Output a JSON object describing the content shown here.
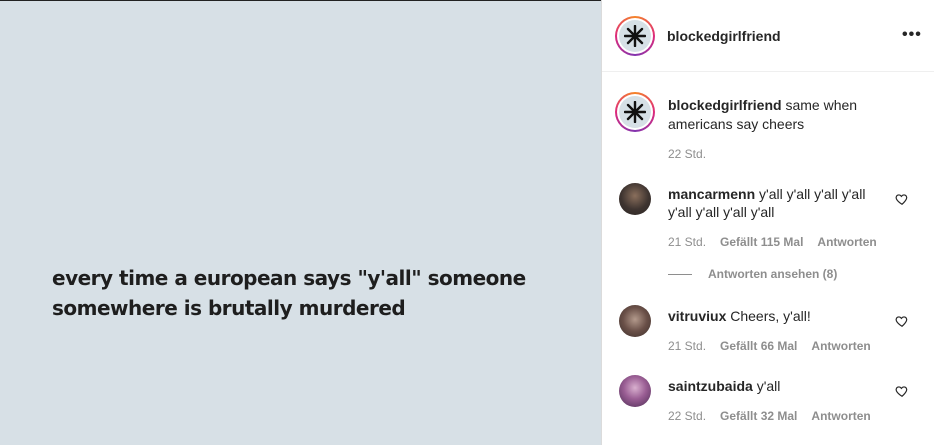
{
  "post": {
    "image_text": "every time a european says \"y'all\" someone somewhere is brutally murdered"
  },
  "header": {
    "username": "blockedgirlfriend",
    "more_label": "•••"
  },
  "caption": {
    "username": "blockedgirlfriend",
    "text": "same when americans say cheers",
    "time": "22 Std."
  },
  "comments": [
    {
      "username": "mancarmenn",
      "text": "y'all y'all y'all y'all y'all y'all y'all y'all",
      "time": "21 Std.",
      "likes": "Gefällt 115 Mal",
      "reply": "Antworten",
      "view_replies": "Antworten ansehen (8)"
    },
    {
      "username": "vitruviux",
      "text": "Cheers, y'all!",
      "time": "21 Std.",
      "likes": "Gefällt 66 Mal",
      "reply": "Antworten"
    },
    {
      "username": "saintzubaida",
      "text": "y'all",
      "time": "22 Std.",
      "likes": "Gefällt 32 Mal",
      "reply": "Antworten"
    }
  ],
  "colors": {
    "image_bg": "#d7e0e6",
    "text": "#262626",
    "muted": "#8e8e8e"
  }
}
